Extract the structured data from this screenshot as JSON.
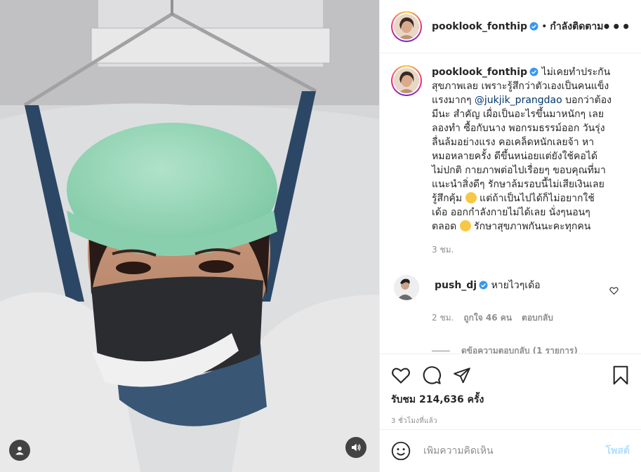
{
  "post": {
    "username": "pooklook_fonthip",
    "follow_status": "กำลังติดตาม",
    "more_icon": "more-horizontal-icon",
    "caption_lines": [
      "ไม่เคยทำประกัน",
      "สุขภาพเลย เพราะรู้สึกว่าตัวเองเป็นคนแข็ง",
      "แรงมากๆ",
      "บอกว่าต้อง",
      "มีนะ สำคัญ เผื่อเป็นอะไรขึ้นมาหนักๆ เลย",
      "ลองทำ ซื้อกับนาง พอกรมธรรม์ออก วันรุ่ง",
      "ลื่นล้มอย่างแรง คอเคล็ดหนักเลยจ้า หา",
      "หมอหลายครั้ง ดีขึ้นหน่อยแต่ยังใช้คอได้",
      "ไม่ปกติ กายภาพต่อไปเรื่อยๆ ขอบคุณที่มา",
      "แนะนำสิ่งดีๆ รักษาล้มรอบนี้ไม่เสียเงินเลย",
      "รู้สึกคุ้ม",
      "แต่ถ้าเป็นไปได้ก็ไม่อยากใช้",
      "เด้อ ออกกำลังกายไม่ได้เลย นั่งๆนอนๆ",
      "ตลอด",
      "รักษาสุขภาพกันนะคะทุกคน"
    ],
    "mention": "@jukjik_prangdao",
    "caption_time": "3 ชม.",
    "views_label": "รับชม 214,636 ครั้ง",
    "posted_ago": "3 ชั่วโมงที่แล้ว"
  },
  "comment": {
    "username": "push_dj",
    "text": "หายไวๆเด้อ",
    "time": "2 ชม.",
    "likes": "ถูกใจ 46 คน",
    "reply": "ตอบกลับ",
    "view_replies": "ดูข้อความตอบกลับ (1 รายการ)"
  },
  "composer": {
    "placeholder": "เพิ่มความคิดเห็น",
    "post_label": "โพสต์"
  },
  "colors": {
    "verified": "#3897f0",
    "post_button": "#b2dffc",
    "secondary_text": "#8e8e8e",
    "mention": "#00376b"
  }
}
